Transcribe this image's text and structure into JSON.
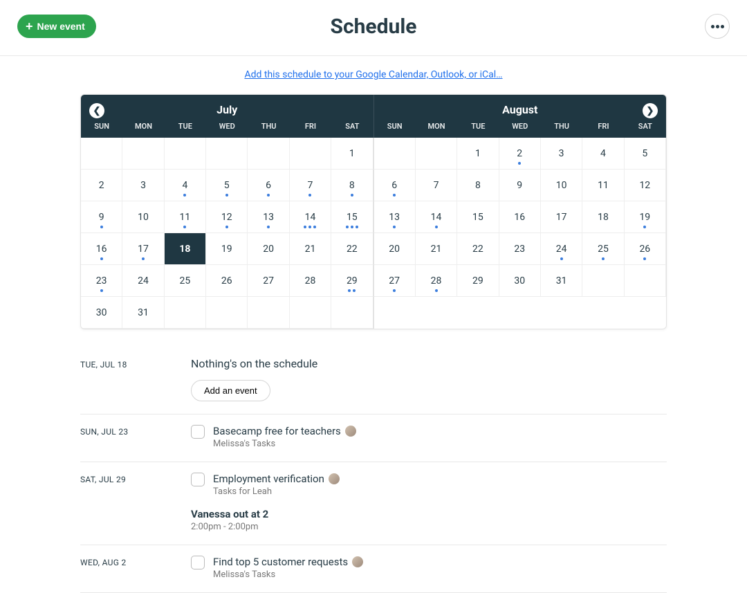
{
  "header": {
    "new_event_label": "New event",
    "title": "Schedule",
    "add_schedule_link": "Add this schedule to your Google Calendar, Outlook, or iCal…"
  },
  "calendar": {
    "month_left": "July",
    "month_right": "August",
    "dow": [
      "SUN",
      "MON",
      "TUE",
      "WED",
      "THU",
      "FRI",
      "SAT"
    ],
    "left_weeks": [
      [
        {
          "n": ""
        },
        {
          "n": ""
        },
        {
          "n": ""
        },
        {
          "n": ""
        },
        {
          "n": ""
        },
        {
          "n": ""
        },
        {
          "n": "1"
        }
      ],
      [
        {
          "n": "2"
        },
        {
          "n": "3"
        },
        {
          "n": "4",
          "dots": 1
        },
        {
          "n": "5",
          "dots": 1
        },
        {
          "n": "6",
          "dots": 1
        },
        {
          "n": "7",
          "dots": 1
        },
        {
          "n": "8",
          "dots": 1
        }
      ],
      [
        {
          "n": "9",
          "dots": 1
        },
        {
          "n": "10"
        },
        {
          "n": "11",
          "dots": 1
        },
        {
          "n": "12",
          "dots": 1
        },
        {
          "n": "13",
          "dots": 1
        },
        {
          "n": "14",
          "dots": 3
        },
        {
          "n": "15",
          "dots": 3
        }
      ],
      [
        {
          "n": "16",
          "dots": 1
        },
        {
          "n": "17",
          "dots": 1
        },
        {
          "n": "18",
          "today": true
        },
        {
          "n": "19"
        },
        {
          "n": "20"
        },
        {
          "n": "21"
        },
        {
          "n": "22"
        }
      ],
      [
        {
          "n": "23",
          "dots": 1
        },
        {
          "n": "24"
        },
        {
          "n": "25"
        },
        {
          "n": "26"
        },
        {
          "n": "27"
        },
        {
          "n": "28"
        },
        {
          "n": "29",
          "dots": 2
        }
      ],
      [
        {
          "n": "30"
        },
        {
          "n": "31"
        },
        {
          "n": ""
        },
        {
          "n": ""
        },
        {
          "n": ""
        },
        {
          "n": ""
        },
        {
          "n": ""
        }
      ]
    ],
    "right_weeks": [
      [
        {
          "n": ""
        },
        {
          "n": ""
        },
        {
          "n": "1"
        },
        {
          "n": "2",
          "dots": 1
        },
        {
          "n": "3"
        },
        {
          "n": "4"
        },
        {
          "n": "5"
        }
      ],
      [
        {
          "n": "6",
          "dots": 1
        },
        {
          "n": "7"
        },
        {
          "n": "8"
        },
        {
          "n": "9"
        },
        {
          "n": "10"
        },
        {
          "n": "11"
        },
        {
          "n": "12"
        }
      ],
      [
        {
          "n": "13",
          "dots": 1
        },
        {
          "n": "14",
          "dots": 1
        },
        {
          "n": "15"
        },
        {
          "n": "16"
        },
        {
          "n": "17"
        },
        {
          "n": "18"
        },
        {
          "n": "19",
          "dots": 1
        }
      ],
      [
        {
          "n": "20"
        },
        {
          "n": "21"
        },
        {
          "n": "22"
        },
        {
          "n": "23"
        },
        {
          "n": "24",
          "dots": 1
        },
        {
          "n": "25",
          "dots": 1
        },
        {
          "n": "26",
          "dots": 1
        }
      ],
      [
        {
          "n": "27",
          "dots": 1
        },
        {
          "n": "28",
          "dots": 1
        },
        {
          "n": "29"
        },
        {
          "n": "30"
        },
        {
          "n": "31"
        },
        {
          "n": ""
        },
        {
          "n": ""
        }
      ]
    ]
  },
  "agenda": [
    {
      "date": "TUE, JUL 18",
      "empty": true,
      "empty_text": "Nothing's on the schedule",
      "add_label": "Add an event"
    },
    {
      "date": "SUN, JUL 23",
      "items": [
        {
          "title": "Basecamp free for teachers",
          "sub": "Melissa's Tasks",
          "avatar": true
        }
      ]
    },
    {
      "date": "SAT, JUL 29",
      "items": [
        {
          "title": "Employment verification",
          "sub": "Tasks for Leah",
          "avatar": true
        }
      ],
      "event": {
        "title": "Vanessa out at 2",
        "time": "2:00pm - 2:00pm"
      }
    },
    {
      "date": "WED, AUG 2",
      "items": [
        {
          "title": "Find top 5 customer requests",
          "sub": "Melissa's Tasks",
          "avatar": true
        }
      ]
    }
  ]
}
